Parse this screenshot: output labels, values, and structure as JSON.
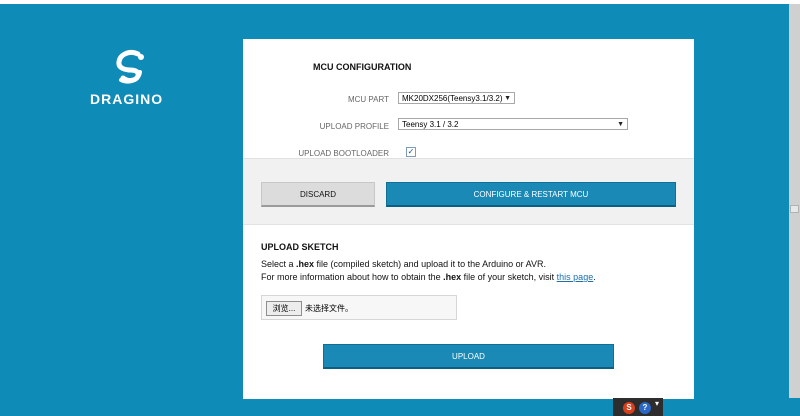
{
  "brand": {
    "name": "DRAGINO",
    "logo_icon": "dragino-logo-icon"
  },
  "mcu_config": {
    "title": "MCU CONFIGURATION",
    "mcu_part_label": "MCU PART",
    "mcu_part_value": "MK20DX256(Teensy3.1/3.2)",
    "upload_profile_label": "UPLOAD PROFILE",
    "upload_profile_value": "Teensy 3.1 / 3.2",
    "upload_bootloader_label": "UPLOAD BOOTLOADER",
    "upload_bootloader_checked": true
  },
  "actions": {
    "discard_label": "DISCARD",
    "configure_label": "CONFIGURE & RESTART MCU"
  },
  "upload": {
    "title": "UPLOAD SKETCH",
    "line1_prefix": "Select a ",
    "line1_strong": ".hex",
    "line1_suffix": " file (compiled sketch) and upload it to the Arduino or AVR.",
    "line2_prefix": "For more information about how to obtain the ",
    "line2_strong": ".hex",
    "line2_mid": " file of your sketch, visit ",
    "line2_link": "this page",
    "line2_end": ".",
    "browse_label": "浏览...",
    "file_status": "未选择文件。",
    "upload_button_label": "UPLOAD"
  },
  "tray": {
    "icon1": "S",
    "icon2": "?",
    "caret": "▾"
  },
  "colors": {
    "background": "#0f8bb8",
    "primary_button": "#1a89b5",
    "panel": "#ffffff"
  }
}
